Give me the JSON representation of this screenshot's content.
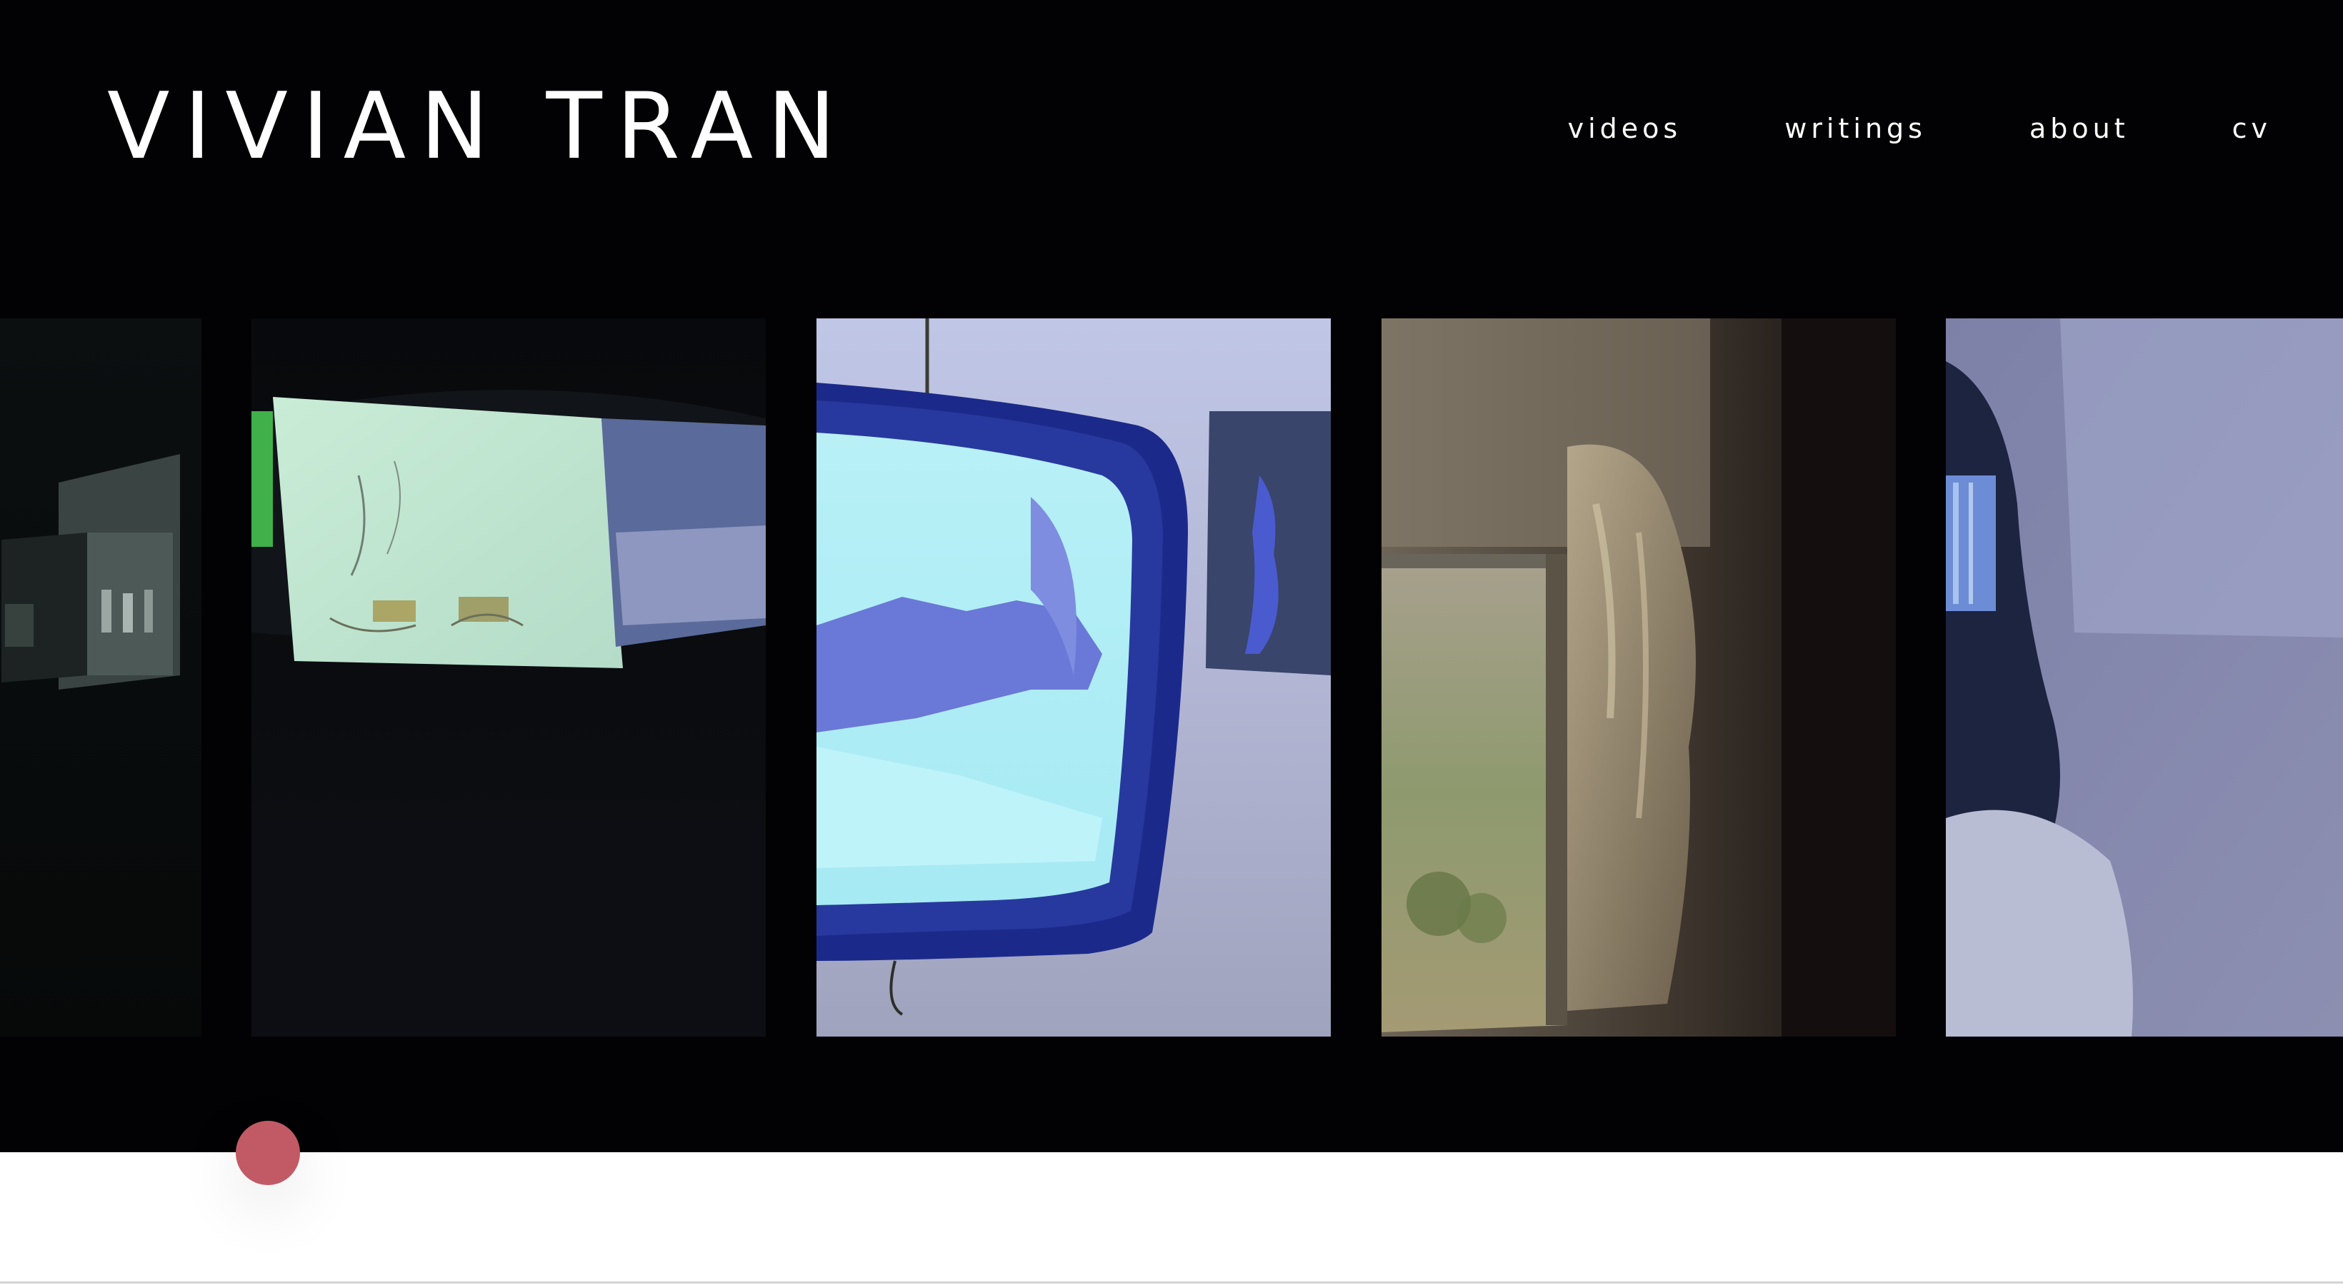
{
  "header": {
    "title": "VIVIAN TRAN"
  },
  "nav": {
    "items": [
      {
        "label": "videos"
      },
      {
        "label": "writings"
      },
      {
        "label": "about"
      },
      {
        "label": "cv"
      }
    ]
  },
  "gallery": {
    "tiles": [
      {
        "subject": "dark room with small projected screens"
      },
      {
        "subject": "projection of sketch on paper in dark room"
      },
      {
        "subject": "blue-framed hanging monitor"
      },
      {
        "subject": "window with curtain in dim light"
      },
      {
        "subject": "person with dark hair facing a wall"
      }
    ]
  },
  "colors": {
    "background_dark": "#020204",
    "text": "#ffffff",
    "scroll_dot": "#c25a66"
  }
}
